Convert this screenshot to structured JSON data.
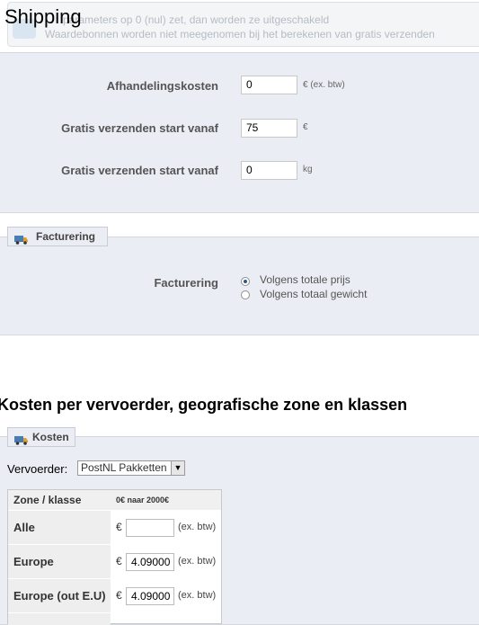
{
  "notice": {
    "line1": "parameters op 0 (nul) zet, dan worden ze uitgeschakeld",
    "line2": "Waardebonnen worden niet meegenomen bij het berekenen van gratis verzenden"
  },
  "page_title": "Shipping",
  "settings": {
    "handling": {
      "label": "Afhandelingskosten",
      "value": "0",
      "unit": "€ (ex. btw)"
    },
    "free_price": {
      "label": "Gratis verzenden start vanaf",
      "value": "75",
      "unit": "€"
    },
    "free_weight": {
      "label": "Gratis verzenden start vanaf",
      "value": "0",
      "unit": "kg"
    }
  },
  "billing": {
    "legend": "Facturering",
    "label": "Facturering",
    "options": [
      {
        "label": "Volgens totale prijs",
        "selected": true
      },
      {
        "label": "Volgens totaal gewicht",
        "selected": false
      }
    ]
  },
  "costs_section": {
    "heading": "Kosten per vervoerder, geografische zone en klassen",
    "legend": "Kosten",
    "carrier_label": "Vervoerder:",
    "carrier_selected": "PostNL Pakketten",
    "table": {
      "col_zone": "Zone / klasse",
      "col_range": "0€ naar 2000€",
      "rows": [
        {
          "zone": "Alle",
          "currency": "€",
          "value": "",
          "suffix": "(ex. btw)"
        },
        {
          "zone": "Europe",
          "currency": "€",
          "value": "4.09000",
          "suffix": "(ex. btw)"
        },
        {
          "zone": "Europe (out E.U)",
          "currency": "€",
          "value": "4.09000",
          "suffix": "(ex. btw)"
        }
      ]
    }
  },
  "colors": {
    "panel_bg": "#ebedf4",
    "radio_dot": "#2a5a8c"
  },
  "icons": {
    "notice": "info-icon",
    "legend": "truck-icon",
    "select": "chevron-down-icon"
  }
}
